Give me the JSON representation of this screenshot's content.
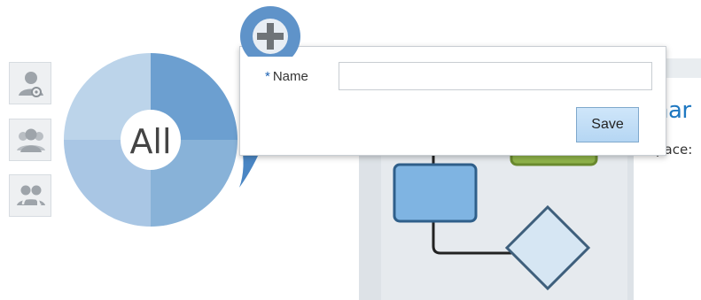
{
  "roles_panel": {
    "buttons": [
      {
        "name": "user-gear-icon"
      },
      {
        "name": "users-group-icon"
      },
      {
        "name": "users-swap-icon"
      }
    ]
  },
  "segment_chart": {
    "center_label": "All",
    "colors": {
      "dark": "#6c9fd0",
      "medium": "#88b2d8",
      "light": "#a9c6e4",
      "lighter": "#bcd4ea"
    }
  },
  "add_button": {
    "icon": "plus-icon",
    "color": "#5f93c9"
  },
  "popup": {
    "name_label": "Name",
    "required_marker": "*",
    "name_value": "",
    "save_label": "Save"
  },
  "background": {
    "title_fragment": "har",
    "subtitle_fragment": "pace:"
  },
  "diagram": {
    "colors": {
      "panel": "#dde2e7",
      "box_fill": "#7fb4e2",
      "box_stroke": "#2f5f8a",
      "diamond_fill": "#d6e6f3",
      "diamond_stroke": "#3e5f7c",
      "green": "#8fb34a"
    }
  }
}
